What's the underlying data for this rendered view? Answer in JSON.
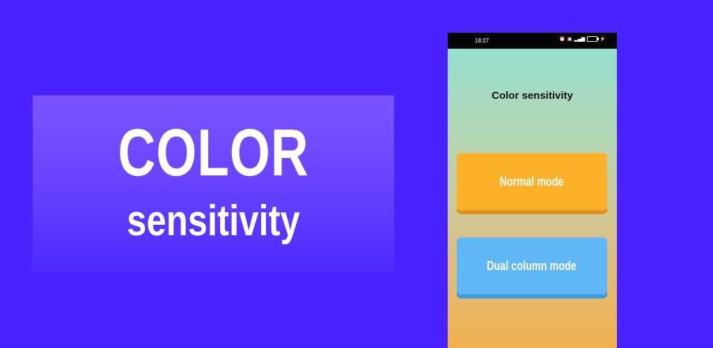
{
  "promo": {
    "title_line1": "COLOR",
    "title_line2": "sensitivity"
  },
  "phone": {
    "status_bar": {
      "time": "18:27",
      "icons": [
        "alarm-icon",
        "nfc-icon",
        "signal-icon",
        "battery-icon"
      ],
      "battery": "88"
    },
    "app_title": "Color sensitivity",
    "buttons": {
      "normal_label": "Normal mode",
      "dual_label": "Dual column mode"
    }
  },
  "colors": {
    "background": "#4a22ff",
    "normal_button": "#fbb02a",
    "dual_button": "#5fb8f5"
  }
}
